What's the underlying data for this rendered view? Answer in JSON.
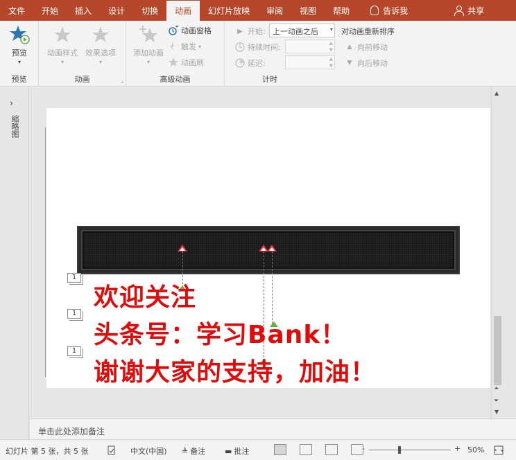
{
  "tabs": [
    {
      "label": "文件",
      "active": false
    },
    {
      "label": "开始",
      "active": false
    },
    {
      "label": "插入",
      "active": false
    },
    {
      "label": "设计",
      "active": false
    },
    {
      "label": "切换",
      "active": false
    },
    {
      "label": "动画",
      "active": true
    },
    {
      "label": "幻灯片放映",
      "active": false
    },
    {
      "label": "审阅",
      "active": false
    },
    {
      "label": "视图",
      "active": false
    },
    {
      "label": "帮助",
      "active": false
    }
  ],
  "tell_me": "告诉我",
  "share": "共享",
  "ribbon": {
    "preview": {
      "button": "预览",
      "group": "预览"
    },
    "animation": {
      "style_button": "动画样式",
      "effect_button": "效果选项",
      "group": "动画"
    },
    "advanced": {
      "add_button": "添加动画",
      "pane_button": "动画窗格",
      "trigger_button": "触发",
      "painter_button": "动画刷",
      "group": "高级动画"
    },
    "timing": {
      "start_label": "开始:",
      "start_value": "上一动画之后",
      "duration_label": "持续时间:",
      "duration_value": "",
      "delay_label": "延迟:",
      "delay_value": "",
      "reorder_label": "对动画重新排序",
      "move_earlier": "向前移动",
      "move_later": "向后移动",
      "group": "计时"
    }
  },
  "thumbnail_pane_label": "缩略图",
  "slide": {
    "anim_numbers": [
      "1",
      "1",
      "1"
    ],
    "lines": [
      "欢迎关注",
      "头条号：学习Bank！",
      "谢谢大家的支持，加油！"
    ]
  },
  "notes_placeholder": "单击此处添加备注",
  "status": {
    "slide_info": "幻灯片 第 5 张，共 5 张",
    "language": "中文(中国)",
    "notes_btn": "备注",
    "comments_btn": "批注",
    "zoom_minus": "-",
    "zoom_plus": "+",
    "zoom_level": "50%"
  },
  "colors": {
    "accent": "#b7472a",
    "slide_text": "#e00b0b"
  }
}
